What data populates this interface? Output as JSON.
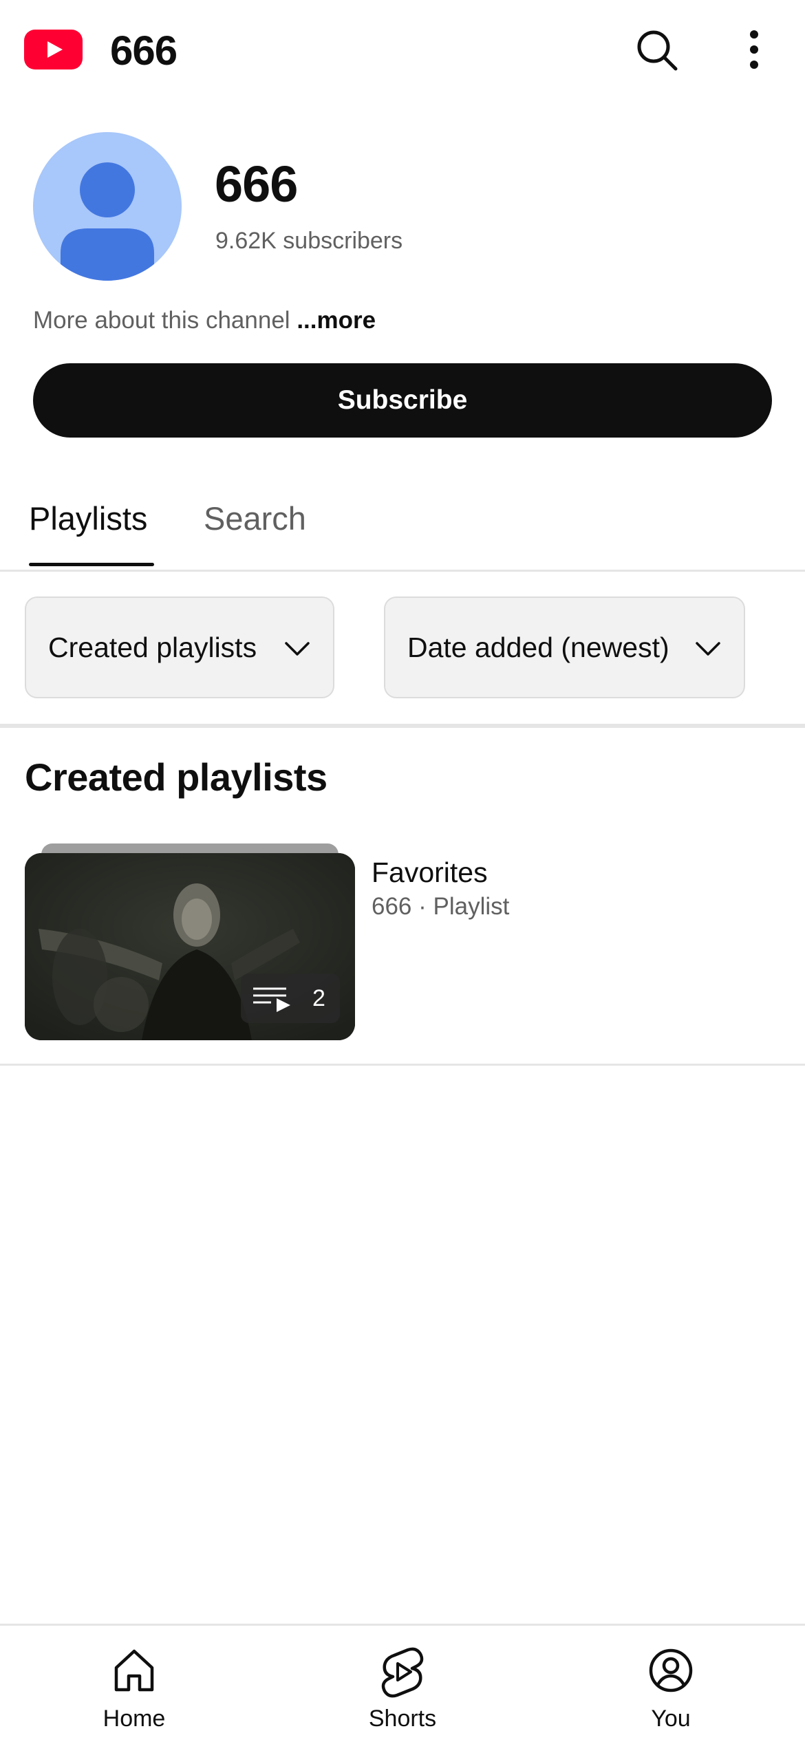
{
  "header": {
    "app_title": "666",
    "logo_icon": "youtube-logo-icon",
    "search_icon": "search-icon",
    "more_icon": "more-vert-icon"
  },
  "channel": {
    "name": "666",
    "subscribers": "9.62K subscribers",
    "about_text": "More about this channel",
    "about_more": "...more",
    "subscribe_label": "Subscribe"
  },
  "tabs": [
    {
      "label": "Playlists",
      "selected": true
    },
    {
      "label": "Search",
      "selected": false
    }
  ],
  "filters": {
    "type": "Created playlists",
    "sort": "Date added (newest)"
  },
  "section": {
    "title": "Created playlists"
  },
  "playlists": [
    {
      "title": "Favorites",
      "meta": "666 · Playlist",
      "video_count": "2"
    }
  ],
  "bottom_nav": [
    {
      "label": "Home",
      "icon": "home-icon"
    },
    {
      "label": "Shorts",
      "icon": "shorts-icon"
    },
    {
      "label": "You",
      "icon": "account-circle-icon"
    }
  ],
  "colors": {
    "brand_red": "#ff0033",
    "avatar_bg": "#a8c7fa",
    "avatar_fg": "#4377e0",
    "primary_text": "#0f0f0f",
    "secondary_text": "#606060"
  }
}
